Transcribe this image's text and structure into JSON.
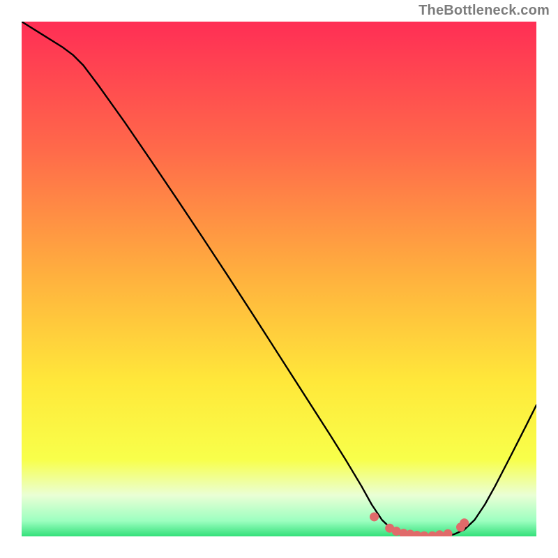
{
  "attribution": "TheBottleneck.com",
  "chart_data": {
    "type": "line",
    "title": "",
    "xlabel": "",
    "ylabel": "",
    "x_range": [
      0,
      100
    ],
    "y_range": [
      0,
      100
    ],
    "background_gradient": {
      "stops": [
        {
          "offset": 0.0,
          "color": "#ff2e55"
        },
        {
          "offset": 0.25,
          "color": "#ff6a4a"
        },
        {
          "offset": 0.5,
          "color": "#ffb23e"
        },
        {
          "offset": 0.7,
          "color": "#ffe83a"
        },
        {
          "offset": 0.85,
          "color": "#f8ff4a"
        },
        {
          "offset": 0.92,
          "color": "#eaffd5"
        },
        {
          "offset": 0.97,
          "color": "#9cffc0"
        },
        {
          "offset": 1.0,
          "color": "#33e07a"
        }
      ]
    },
    "curve": {
      "color": "#000000",
      "width": 2.4,
      "points": [
        {
          "x": 0,
          "y": 100.0
        },
        {
          "x": 4,
          "y": 97.5
        },
        {
          "x": 8,
          "y": 95.0
        },
        {
          "x": 10,
          "y": 93.5
        },
        {
          "x": 12,
          "y": 91.5
        },
        {
          "x": 15,
          "y": 87.5
        },
        {
          "x": 20,
          "y": 80.5
        },
        {
          "x": 25,
          "y": 73.2
        },
        {
          "x": 30,
          "y": 65.8
        },
        {
          "x": 35,
          "y": 58.3
        },
        {
          "x": 40,
          "y": 50.7
        },
        {
          "x": 45,
          "y": 43.0
        },
        {
          "x": 50,
          "y": 35.2
        },
        {
          "x": 55,
          "y": 27.4
        },
        {
          "x": 60,
          "y": 19.6
        },
        {
          "x": 63,
          "y": 14.8
        },
        {
          "x": 66,
          "y": 9.8
        },
        {
          "x": 68,
          "y": 6.2
        },
        {
          "x": 70,
          "y": 3.2
        },
        {
          "x": 72,
          "y": 1.3
        },
        {
          "x": 74,
          "y": 0.4
        },
        {
          "x": 76,
          "y": 0.1
        },
        {
          "x": 78,
          "y": 0.0
        },
        {
          "x": 80,
          "y": 0.0
        },
        {
          "x": 82,
          "y": 0.1
        },
        {
          "x": 84,
          "y": 0.4
        },
        {
          "x": 86,
          "y": 1.3
        },
        {
          "x": 88,
          "y": 3.2
        },
        {
          "x": 90,
          "y": 6.2
        },
        {
          "x": 92,
          "y": 9.8
        },
        {
          "x": 95,
          "y": 15.6
        },
        {
          "x": 98,
          "y": 21.5
        },
        {
          "x": 100,
          "y": 25.5
        }
      ]
    },
    "markers": {
      "color": "#e06a6a",
      "radius": 6.5,
      "points": [
        {
          "x": 68.5,
          "y": 3.8
        },
        {
          "x": 71.5,
          "y": 1.6
        },
        {
          "x": 72.8,
          "y": 1.0
        },
        {
          "x": 74.2,
          "y": 0.6
        },
        {
          "x": 75.5,
          "y": 0.4
        },
        {
          "x": 76.8,
          "y": 0.2
        },
        {
          "x": 78.2,
          "y": 0.1
        },
        {
          "x": 79.8,
          "y": 0.1
        },
        {
          "x": 81.2,
          "y": 0.3
        },
        {
          "x": 82.8,
          "y": 0.5
        },
        {
          "x": 85.3,
          "y": 1.8
        },
        {
          "x": 86.0,
          "y": 2.6
        }
      ]
    }
  }
}
